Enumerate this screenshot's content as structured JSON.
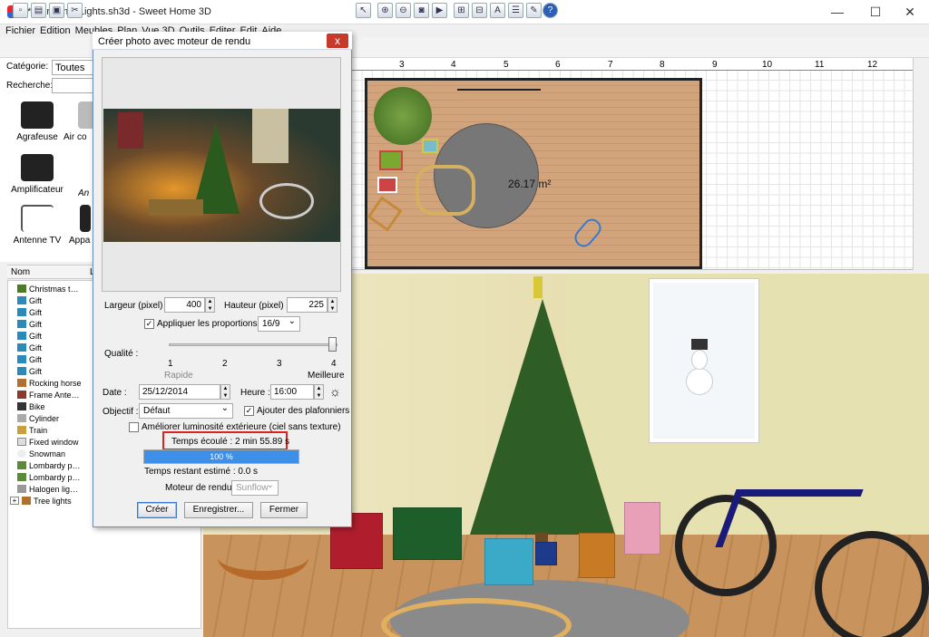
{
  "window": {
    "title": "* ChristmasLights.sh3d - Sweet Home 3D",
    "minimize": "—",
    "maximize": "☐",
    "close": "✕"
  },
  "menu": [
    "Fichier",
    "Edition",
    "Meubles",
    "Plan",
    "Vue 3D",
    "Outils",
    "Editer",
    "Edit",
    "Aide"
  ],
  "catalog": {
    "category_label": "Catégorie:",
    "category_value": "Toutes",
    "search_label": "Recherche:",
    "items": [
      "Agrafeuse",
      "Air co",
      "Amplificateur",
      "An",
      "Antenne TV",
      "Appa"
    ]
  },
  "furniture": {
    "columns": [
      "Nom",
      "L"
    ],
    "rows": [
      "Christmas t…",
      "Gift",
      "Gift",
      "Gift",
      "Gift",
      "Gift",
      "Gift",
      "Gift",
      "Rocking horse",
      "Frame Ante…",
      "Bike",
      "Cylinder",
      "Train",
      "Fixed window",
      "Snowman",
      "Lombardy p…",
      "Lombardy p…",
      "Halogen lig…",
      "Tree lights"
    ]
  },
  "plan": {
    "ruler": [
      "3",
      "4",
      "5",
      "6",
      "7",
      "8",
      "9",
      "10",
      "11",
      "12"
    ],
    "area": "26.17 m²"
  },
  "dialog": {
    "title": "Créer photo avec moteur de rendu",
    "close": "x",
    "width_label": "Largeur (pixel) :",
    "width_value": "400",
    "height_label": "Hauteur (pixel) :",
    "height_value": "225",
    "proportions_label": "Appliquer les proportions :",
    "proportions_value": "16/9",
    "quality_label": "Qualité :",
    "quality_ticks": [
      "1",
      "2",
      "3",
      "4"
    ],
    "quality_fast": "Rapide",
    "quality_best": "Meilleure",
    "quality_level": 4,
    "date_label": "Date :",
    "date_value": "25/12/2014",
    "time_label": "Heure :",
    "time_value": "16:00",
    "lens_label": "Objectif :",
    "lens_value": "Défaut",
    "ceiling_lights_label": "Ajouter des plafonniers",
    "outdoor_label": "Améliorer luminosité extérieure (ciel sans texture)",
    "elapsed": "Temps écoulé : 2 min 55.89 s",
    "progress_percent": 100,
    "progress_text": "100 %",
    "remaining": "Temps restant estimé : 0.0 s",
    "engine_label": "Moteur de rendu :",
    "engine_value": "Sunflow",
    "create_button": "Créer",
    "save_button": "Enregistrer...",
    "close_button": "Fermer",
    "check_mark": "✓"
  }
}
